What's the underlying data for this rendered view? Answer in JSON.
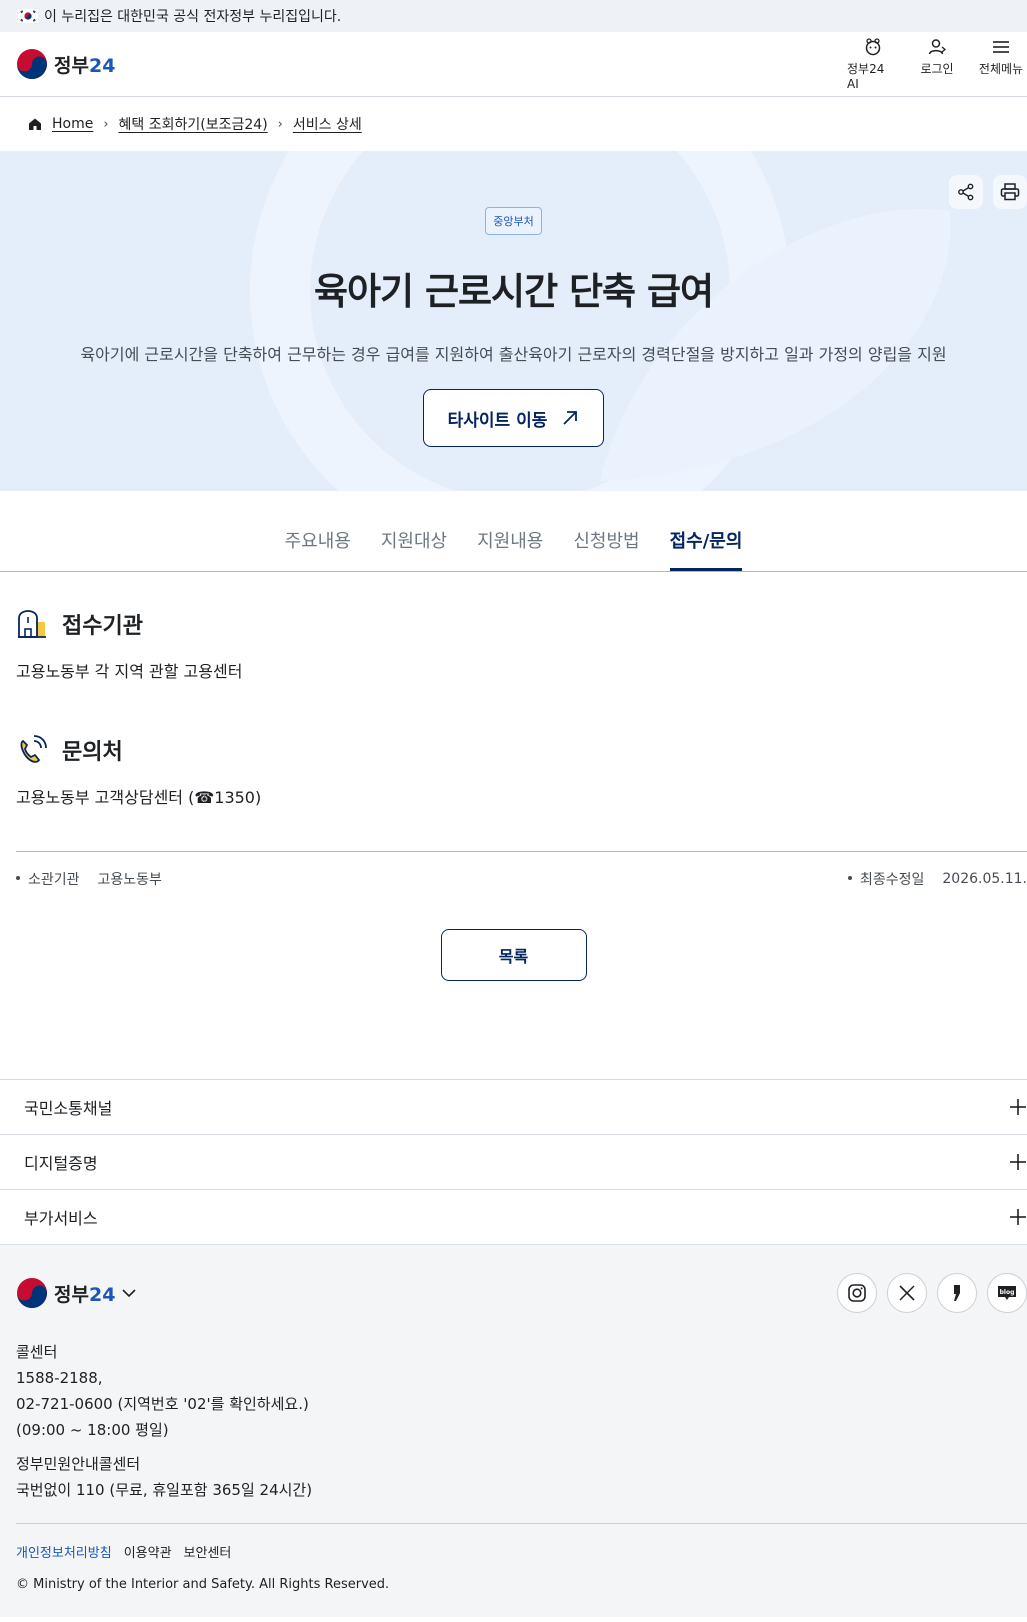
{
  "banner": {
    "text": "이 누리집은 대한민국 공식 전자정부 누리집입니다."
  },
  "header": {
    "logo_text": "정부",
    "logo_num": "24",
    "ai_label": "정부24 AI",
    "login_label": "로그인",
    "menu_label": "전체메뉴"
  },
  "breadcrumb": {
    "home": "Home",
    "level1": "혜택 조회하기(보조금24)",
    "level2": "서비스 상세"
  },
  "hero": {
    "badge": "중앙부처",
    "title": "육아기 근로시간 단축 급여",
    "description": "육아기에 근로시간을 단축하여 근무하는 경우 급여를 지원하여 출산육아기 근로자의 경력단절을 방지하고 일과 가정의 양립을 지원",
    "site_button": "타사이트 이동"
  },
  "tabs": [
    {
      "label": "주요내용"
    },
    {
      "label": "지원대상"
    },
    {
      "label": "지원내용"
    },
    {
      "label": "신청방법"
    },
    {
      "label": "접수/문의"
    }
  ],
  "reception": {
    "title": "접수기관",
    "body": "고용노동부 각 지역 관할 고용센터"
  },
  "contact": {
    "title": "문의처",
    "body": "고용노동부 고객상담센터 (☎1350)"
  },
  "meta": {
    "agency_label": "소관기관",
    "agency_value": "고용노동부",
    "updated_label": "최종수정일",
    "updated_value": "2026.05.11."
  },
  "list_button": "목록",
  "accordions": [
    {
      "label": "국민소통채널"
    },
    {
      "label": "디지털증명"
    },
    {
      "label": "부가서비스"
    }
  ],
  "footer": {
    "call_title": "콜센터",
    "call_line1": "1588-2188,",
    "call_line2": "02-721-0600 (지역번호 '02'를 확인하세요.)",
    "call_hours": "(09:00 ~ 18:00 평일)",
    "gov_title": "정부민원안내콜센터",
    "gov_line": "국번없이 110 (무료, 휴일포함 365일 24시간)",
    "privacy": "개인정보처리방침",
    "terms": "이용약관",
    "security": "보안센터",
    "copyright": "© Ministry of the Interior and Safety. All Rights Reserved."
  },
  "colors": {
    "primary": "#052561",
    "brand_blue": "#1c57b8",
    "hero_bg": "#e4eefb",
    "footer_bg": "#f4f5f6"
  }
}
